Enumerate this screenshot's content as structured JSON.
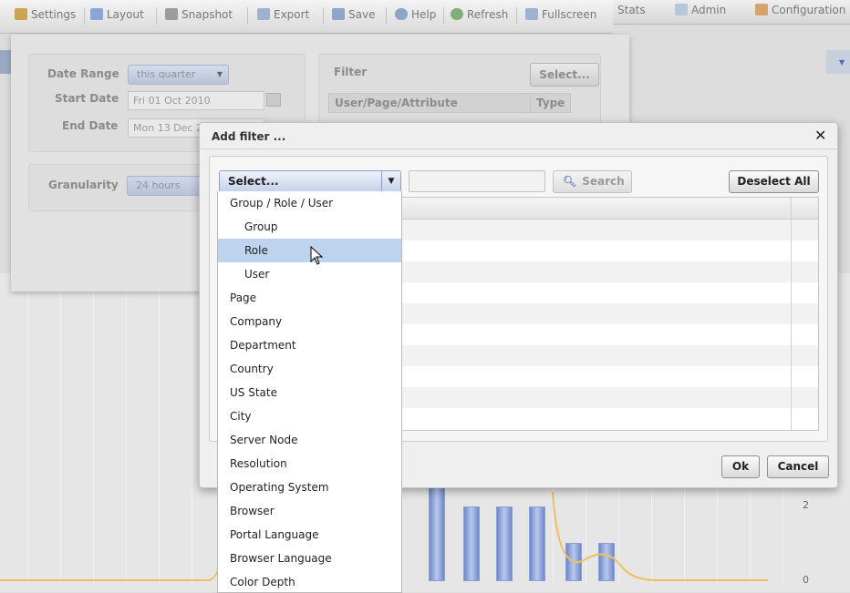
{
  "toolbar": {
    "items": [
      {
        "label": "Settings",
        "icon": "settings-icon",
        "color": "#c9a550"
      },
      {
        "label": "Layout",
        "icon": "layout-icon",
        "color": "#8aa6d6"
      },
      {
        "label": "Snapshot",
        "icon": "snapshot-icon",
        "color": "#9c9c9c"
      },
      {
        "label": "Export",
        "icon": "export-icon",
        "color": "#9fb2cf"
      },
      {
        "label": "Save",
        "icon": "save-icon",
        "color": "#8ea4c8"
      },
      {
        "label": "Help",
        "icon": "help-icon",
        "color": "#8fa4c9"
      },
      {
        "label": "Refresh",
        "icon": "refresh-icon",
        "color": "#7fae76"
      },
      {
        "label": "Fullscreen",
        "icon": "fullscreen-icon",
        "color": "#9fb2cf"
      }
    ]
  },
  "topnav": {
    "stats": "Stats",
    "admin": "Admin",
    "configuration": "Configuration"
  },
  "settings": {
    "date_range_label": "Date Range",
    "date_range_value": "this quarter",
    "start_date_label": "Start Date",
    "start_date_value": "Fri 01 Oct 2010",
    "end_date_label": "End Date",
    "end_date_value": "Mon 13 Dec 2",
    "granularity_label": "Granularity",
    "granularity_value": "24 hours",
    "filter_label": "Filter",
    "filter_select_button": "Select...",
    "filter_col_user": "User/Page/Attribute",
    "filter_col_type": "Type"
  },
  "chart": {
    "y_ticks": [
      "2",
      "0"
    ]
  },
  "dialog": {
    "title": "Add filter ...",
    "close": "✕",
    "combo_value": "Select...",
    "search_button": "Search",
    "search_value": "",
    "deselect_all": "Deselect All",
    "ok": "Ok",
    "cancel": "Cancel"
  },
  "dropdown": {
    "items": [
      {
        "label": "Group / Role / User",
        "indent": false,
        "selected": false
      },
      {
        "label": "Group",
        "indent": true,
        "selected": false
      },
      {
        "label": "Role",
        "indent": true,
        "selected": true
      },
      {
        "label": "User",
        "indent": true,
        "selected": false
      },
      {
        "label": "Page",
        "indent": false,
        "selected": false
      },
      {
        "label": "Company",
        "indent": false,
        "selected": false
      },
      {
        "label": "Department",
        "indent": false,
        "selected": false
      },
      {
        "label": "Country",
        "indent": false,
        "selected": false
      },
      {
        "label": "US State",
        "indent": false,
        "selected": false
      },
      {
        "label": "City",
        "indent": false,
        "selected": false
      },
      {
        "label": "Server Node",
        "indent": false,
        "selected": false
      },
      {
        "label": "Resolution",
        "indent": false,
        "selected": false
      },
      {
        "label": "Operating System",
        "indent": false,
        "selected": false
      },
      {
        "label": "Browser",
        "indent": false,
        "selected": false
      },
      {
        "label": "Portal Language",
        "indent": false,
        "selected": false
      },
      {
        "label": "Browser Language",
        "indent": false,
        "selected": false
      },
      {
        "label": "Color Depth",
        "indent": false,
        "selected": false
      }
    ]
  },
  "colors": {
    "selection": "#bdd3ee",
    "combo_border": "#8d9fc4",
    "chart_line": "#f0c060"
  }
}
